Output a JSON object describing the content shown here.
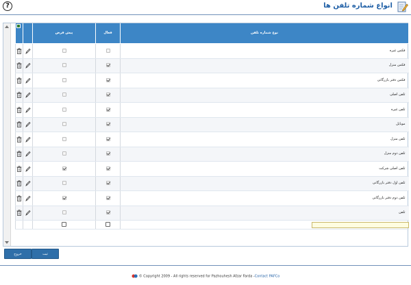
{
  "header": {
    "title": "انواع شماره تلفن ها",
    "help_icon": "help-circle-icon",
    "title_icon": "edit-document-icon"
  },
  "grid": {
    "columns": {
      "default": "پیش فرض",
      "active": "فعال",
      "type": "نوع شماره تلفن"
    },
    "rows": [
      {
        "type": "فكس غيره",
        "active": false,
        "default": false,
        "active_enabled": false
      },
      {
        "type": "فكس منزل",
        "active": true,
        "default": false,
        "active_enabled": true
      },
      {
        "type": "فكس دفتر بازرگانی",
        "active": true,
        "default": false,
        "active_enabled": true
      },
      {
        "type": "تلفن اصلی",
        "active": true,
        "default": false,
        "active_enabled": true
      },
      {
        "type": "تلفن غيره",
        "active": true,
        "default": false,
        "active_enabled": true
      },
      {
        "type": "موبایل",
        "active": true,
        "default": false,
        "active_enabled": true
      },
      {
        "type": "تلفن منزل",
        "active": true,
        "default": false,
        "active_enabled": true
      },
      {
        "type": "تلفن دوم منزل",
        "active": true,
        "default": false,
        "active_enabled": true
      },
      {
        "type": "تلفن اصلی شرکت",
        "active": true,
        "default": true,
        "active_enabled": true
      },
      {
        "type": "تلفن اول دفتر بازرگانی",
        "active": true,
        "default": false,
        "active_enabled": true
      },
      {
        "type": "تلفن دوم دفتر بازرگانی",
        "active": true,
        "default": true,
        "active_enabled": true
      },
      {
        "type": "تلفن",
        "active": true,
        "default": false,
        "active_enabled": true
      }
    ],
    "new_row": {
      "type_value": "",
      "active": false,
      "default": false
    }
  },
  "buttons": {
    "exit": "خروج",
    "submit": "ثبت"
  },
  "footer": {
    "copyright": "© Copyright 2009 - All rights reserved for Pazhouhesh Afzar Farda -",
    "contact": "Contact PAFCo"
  },
  "colors": {
    "header_blue": "#3d86c6",
    "title_blue": "#1f5fa6",
    "button_blue": "#2f6fa9",
    "input_yellow": "#fffde0"
  }
}
